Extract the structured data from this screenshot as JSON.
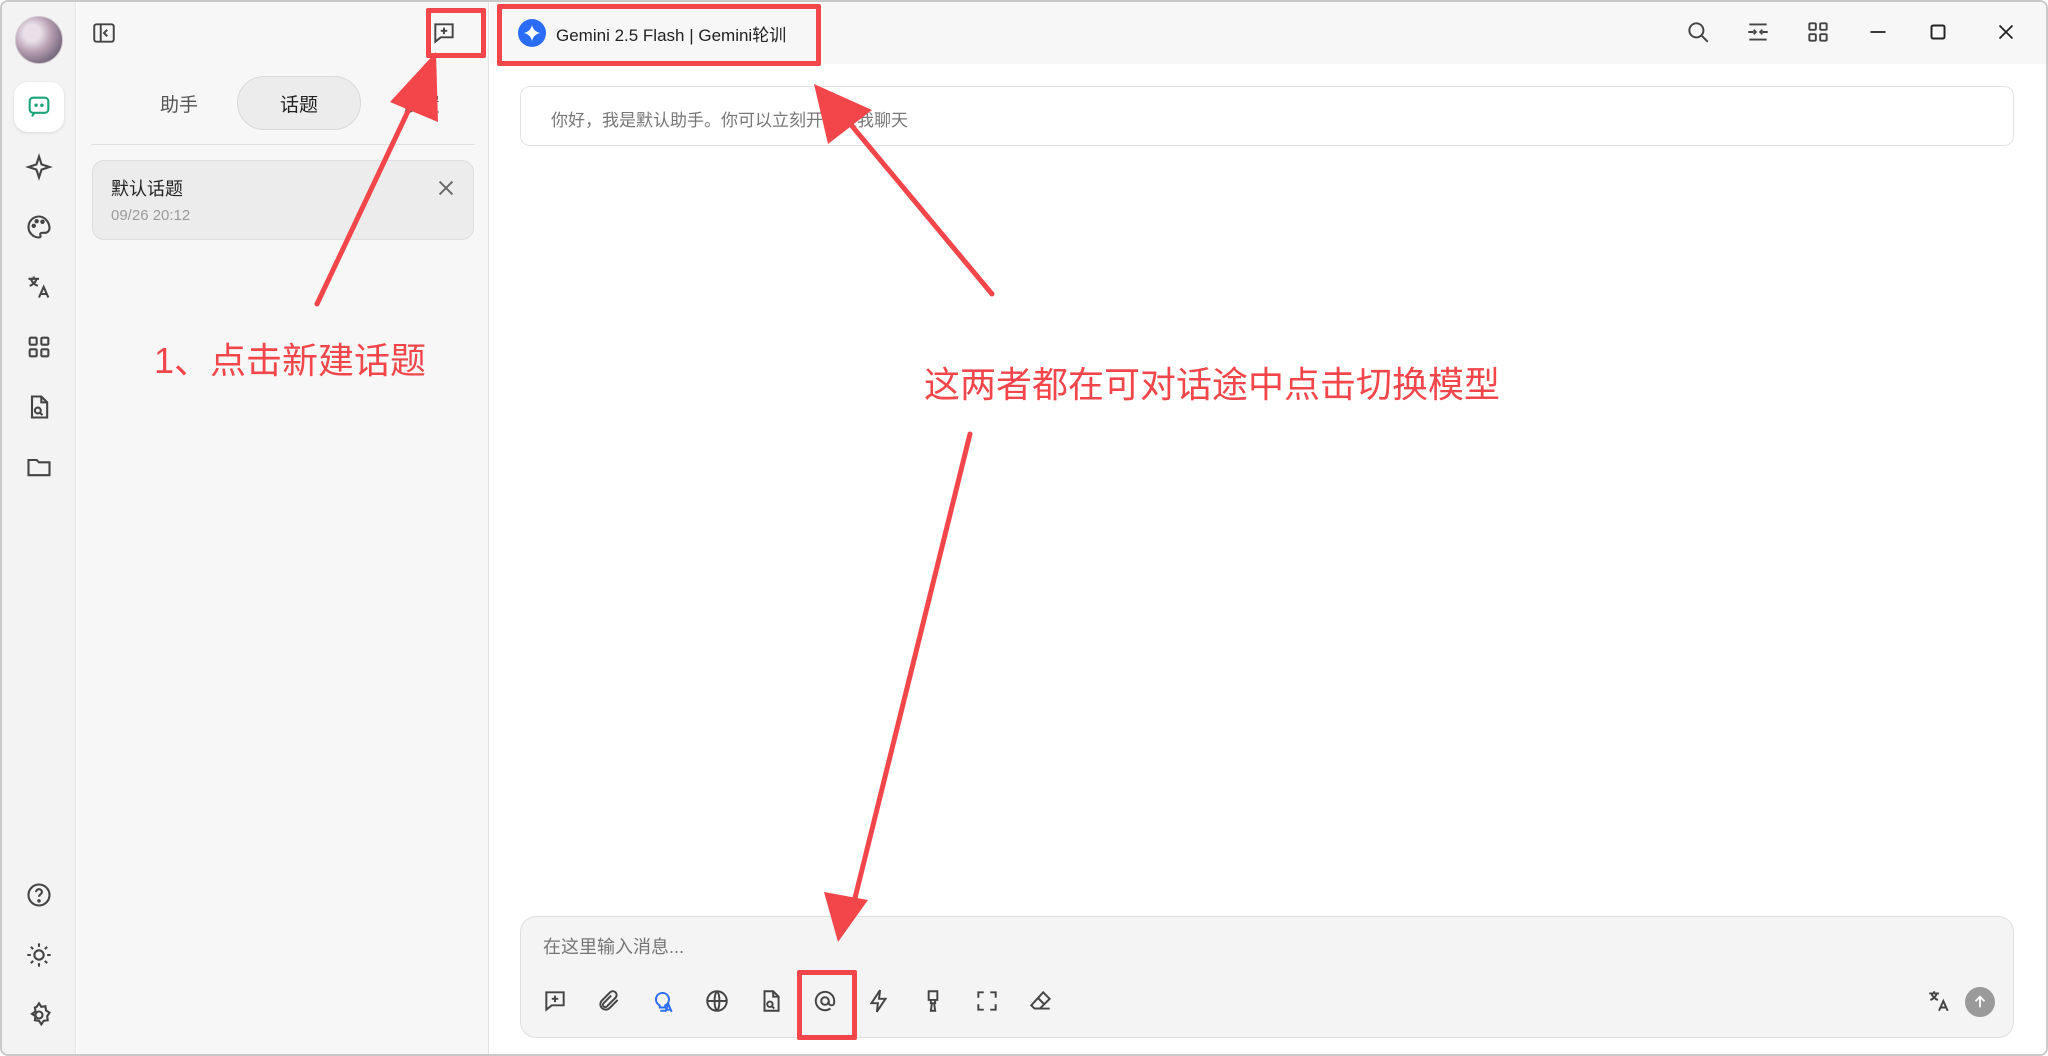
{
  "sidebar": {
    "tabs": [
      {
        "label": "助手"
      },
      {
        "label": "话题"
      },
      {
        "label": "设置"
      }
    ],
    "topics": [
      {
        "title": "默认话题",
        "time": "09/26 20:12"
      }
    ]
  },
  "header": {
    "model_label": "Gemini 2.5 Flash | Gemini轮训"
  },
  "chat": {
    "greeting": "你好，我是默认助手。你可以立刻开始跟我聊天"
  },
  "composer": {
    "placeholder": "在这里输入消息..."
  },
  "annotations": {
    "new_topic_hint": "1、点击新建话题",
    "switch_model_hint": "这两者都在可对话途中点击切换模型"
  },
  "colors": {
    "annotation": "#f2464b",
    "accent_green": "#1aa37a",
    "accent_blue": "#2a6cf5"
  },
  "icons": {
    "rail": [
      "chat-icon",
      "sparkle-icon",
      "palette-icon",
      "translate-icon",
      "apps-grid-icon",
      "document-search-icon",
      "folder-icon",
      "help-icon",
      "theme-icon",
      "settings-icon"
    ],
    "toolbar": [
      "new-topic-icon",
      "attachment-icon",
      "thinking-icon",
      "web-search-icon",
      "knowledge-icon",
      "mention-model-icon",
      "quick-phrase-icon",
      "clear-context-icon",
      "fullscreen-icon",
      "eraser-icon",
      "translate-icon",
      "send-icon"
    ]
  }
}
